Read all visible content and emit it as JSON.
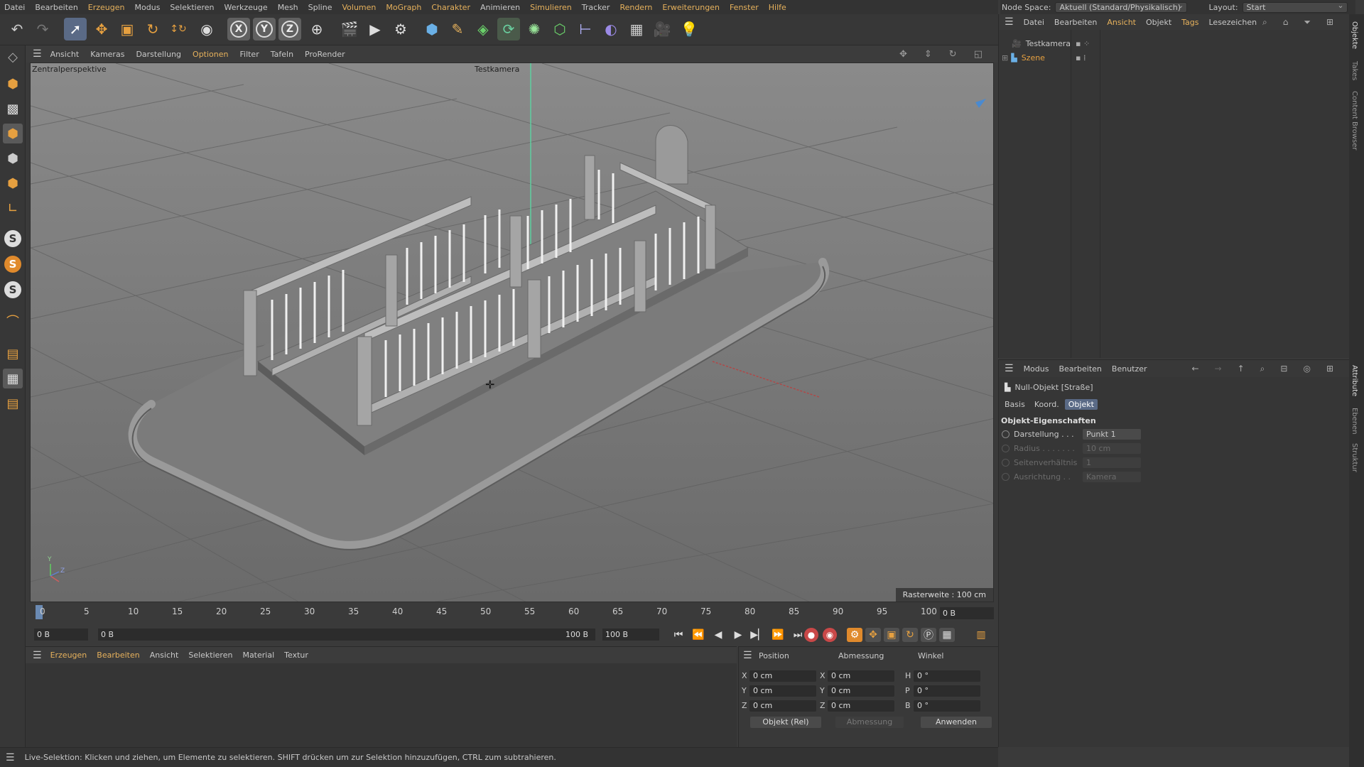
{
  "menubar": {
    "items": [
      "Datei",
      "Bearbeiten",
      "Erzeugen",
      "Modus",
      "Selektieren",
      "Werkzeuge",
      "Mesh",
      "Spline",
      "Volumen",
      "MoGraph",
      "Charakter",
      "Animieren",
      "Simulieren",
      "Tracker",
      "Rendern",
      "Erweiterungen",
      "Fenster",
      "Hilfe"
    ],
    "node_space_label": "Node Space:",
    "node_space_value": "Aktuell (Standard/Physikalisch)",
    "layout_label": "Layout:",
    "layout_value": "Start"
  },
  "viewport": {
    "menu": [
      "Ansicht",
      "Kameras",
      "Darstellung",
      "Optionen",
      "Filter",
      "Tafeln",
      "ProRender"
    ],
    "active_menu": "Optionen",
    "view_name": "Zentralperspektive",
    "camera_name": "Testkamera",
    "raster": "Rasterweite : 100 cm",
    "axis_y": "Y",
    "axis_z": "Z"
  },
  "timeline": {
    "ticks": [
      "0",
      "5",
      "10",
      "15",
      "20",
      "25",
      "30",
      "35",
      "40",
      "45",
      "50",
      "55",
      "60",
      "65",
      "70",
      "75",
      "80",
      "85",
      "90",
      "95",
      "100"
    ],
    "current_frame": "0 B",
    "start_field": "0 B",
    "range_start": "0 B",
    "range_end": "100 B",
    "end_field": "100 B"
  },
  "material_bar": {
    "items": [
      "Erzeugen",
      "Bearbeiten",
      "Ansicht",
      "Selektieren",
      "Material",
      "Textur"
    ]
  },
  "coordinates": {
    "headers": [
      "Position",
      "Abmessung",
      "Winkel"
    ],
    "rows": [
      {
        "axis": "X",
        "pos": "0 cm",
        "size_axis": "X",
        "size": "0 cm",
        "rot_axis": "H",
        "rot": "0 °"
      },
      {
        "axis": "Y",
        "pos": "0 cm",
        "size_axis": "Y",
        "size": "0 cm",
        "rot_axis": "P",
        "rot": "0 °"
      },
      {
        "axis": "Z",
        "pos": "0 cm",
        "size_axis": "Z",
        "size": "0 cm",
        "rot_axis": "B",
        "rot": "0 °"
      }
    ],
    "mode": "Objekt (Rel)",
    "size_mode": "Abmessung",
    "apply": "Anwenden"
  },
  "status": "Live-Selektion: Klicken und ziehen, um Elemente zu selektieren. SHIFT drücken um zur Selektion hinzuzufügen, CTRL zum subtrahieren.",
  "object_manager": {
    "menu": [
      "Datei",
      "Bearbeiten",
      "Ansicht",
      "Objekt",
      "Tags",
      "Lesezeichen"
    ],
    "active_menu": "Ansicht",
    "objects": [
      {
        "name": "Testkamera",
        "color": "#cccccc"
      },
      {
        "name": "Szene",
        "color": "#e6a040"
      }
    ]
  },
  "attributes": {
    "menu": [
      "Modus",
      "Bearbeiten",
      "Benutzer"
    ],
    "title": "Null-Objekt [Straße]",
    "tabs": [
      "Basis",
      "Koord.",
      "Objekt"
    ],
    "active_tab": "Objekt",
    "section": "Objekt-Eigenschaften",
    "props": [
      {
        "label": "Darstellung . . .",
        "value": "Punkt 1",
        "enabled": true
      },
      {
        "label": "Radius . . . . . . .",
        "value": "10 cm",
        "enabled": false
      },
      {
        "label": "Seitenverhältnis",
        "value": "1",
        "enabled": false
      },
      {
        "label": "Ausrichtung . .",
        "value": "Kamera",
        "enabled": false
      }
    ]
  },
  "side_tabs": [
    "Objekte",
    "Takes",
    "Content Browser",
    "Attribute",
    "Ebenen",
    "Struktur"
  ],
  "colors": {
    "accent": "#e6b15c",
    "selection": "#5a6a86",
    "viewport_bg": "#737373"
  }
}
